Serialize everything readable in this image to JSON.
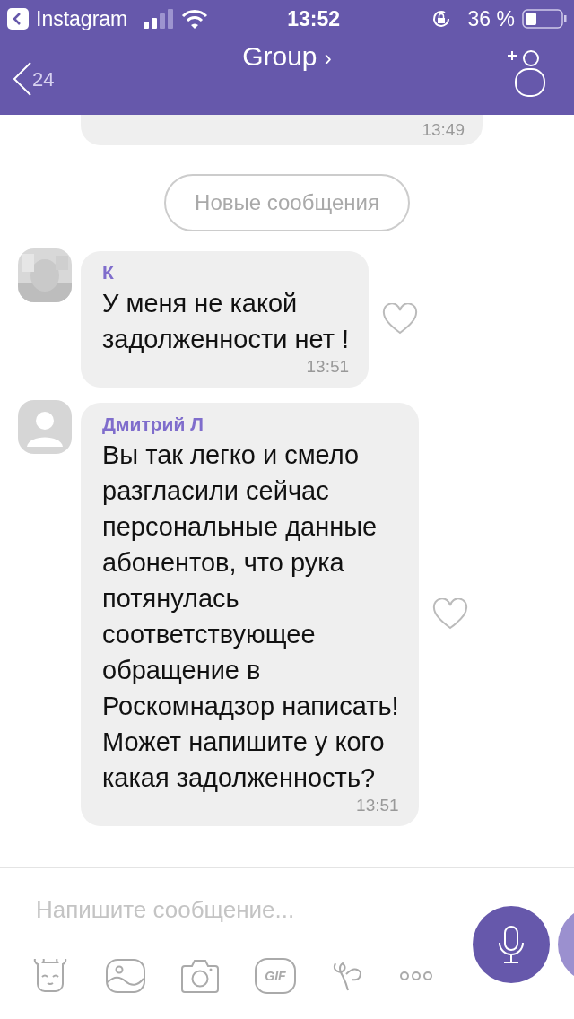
{
  "status_bar": {
    "back_app": "Instagram",
    "time": "13:52",
    "battery": "36 %"
  },
  "header": {
    "title": "Group",
    "chevron": "›",
    "back_count": "24"
  },
  "previous_message": {
    "time": "13:49"
  },
  "new_messages_label": "Новые сообщения",
  "messages": [
    {
      "sender": "К",
      "text": "У меня не какой\nзадолженности нет !",
      "time": "13:51",
      "liked": false
    },
    {
      "sender": "Дмитрий Л",
      "avatar": {
        "kind": "silhouette"
      },
      "text": "Вы так легко и смело\nразгласили сейчас\nперсональные данные\nабонентов, что рука\nпотянулась\nсоответствующее\nобращение в\nРоскомнадзор написать!\nМожет напишите у кого\nкакая задолженность?",
      "time": "13:51",
      "liked": false
    }
  ],
  "composer": {
    "placeholder": "Напишите сообщение...",
    "gif_label": "GIF"
  }
}
